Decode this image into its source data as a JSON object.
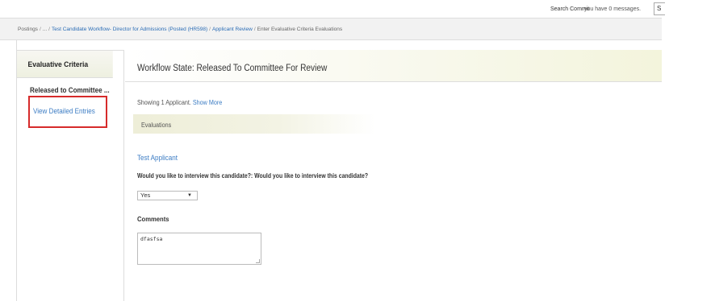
{
  "topbar": {
    "search_label": "Search Commit",
    "messages_text": "you have 0 messages.",
    "cut_button_label": "S"
  },
  "breadcrumb": {
    "root": "Postings",
    "ellipsis": "...",
    "posting": "Test Candidate Workflow- Director for Admissions (Posted (HR598)",
    "review": "Applicant Review",
    "current": "Enter Evaluative Criteria Evaluations"
  },
  "sidebar": {
    "header": "Evaluative Criteria",
    "active_item": "Released to Committee ...",
    "link": "View Detailed Entries"
  },
  "main": {
    "title": "Workflow State: Released To Committee For Review",
    "showing_text": "Showing 1 Applicant.",
    "show_more": "Show More",
    "evaluations_label": "Evaluations",
    "applicant_name": "Test Applicant",
    "question": "Would you like to interview this candidate?: Would you like to interview this candidate?",
    "answer_selected": "Yes",
    "comments_label": "Comments",
    "comments_value": "dfasfsa"
  },
  "colors": {
    "link": "#3d7dc4",
    "highlight": "#d62b2b"
  }
}
